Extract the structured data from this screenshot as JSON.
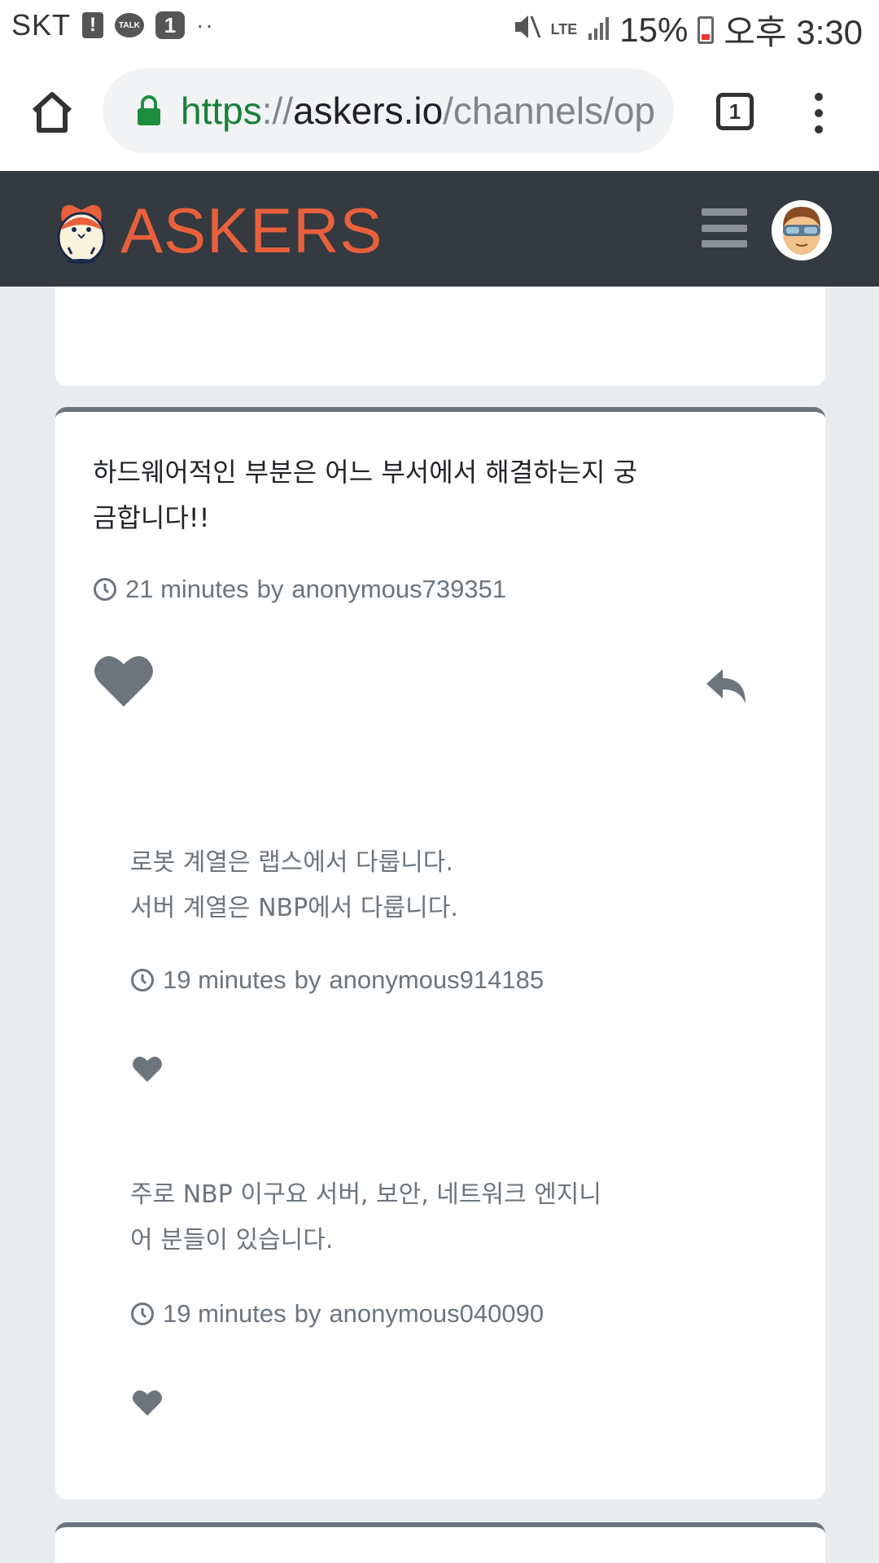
{
  "status_bar": {
    "carrier": "SKT",
    "alert_badge": "!",
    "talk_badge": "TALK",
    "notification_count": "1",
    "more_dots": "··",
    "network": "LTE",
    "battery": "15%",
    "time": "오후 3:30"
  },
  "browser": {
    "url_scheme": "https",
    "url_sep": "://",
    "url_host": "askers.io",
    "url_path": "/channels/op",
    "tab_count": "1"
  },
  "site": {
    "logo_text": "ASKERS",
    "brand_color": "#e8603c",
    "header_bg": "#343a40"
  },
  "question": {
    "text_line1": "하드웨어적인 부분은 어느 부서에서 해결하는지 궁",
    "text_line2": "금합니다!!",
    "time_ago": "21 minutes",
    "by_label": "by",
    "author": "anonymous739351"
  },
  "answers": [
    {
      "line1": "로봇 계열은 랩스에서 다룹니다.",
      "line2": "서버 계열은 NBP에서 다룹니다.",
      "time_ago": "19 minutes",
      "by_label": "by",
      "author": "anonymous914185"
    },
    {
      "line1": "주로 NBP 이구요 서버, 보안, 네트워크 엔지니",
      "line2": "어 분들이 있습니다.",
      "time_ago": "19 minutes",
      "by_label": "by",
      "author": "anonymous040090"
    }
  ],
  "icons": {
    "home": "home-icon",
    "lock": "lock-icon",
    "menu": "more-vert-icon",
    "hamburger": "hamburger-icon",
    "clock": "clock-icon",
    "heart": "heart-icon",
    "reply": "reply-icon"
  }
}
